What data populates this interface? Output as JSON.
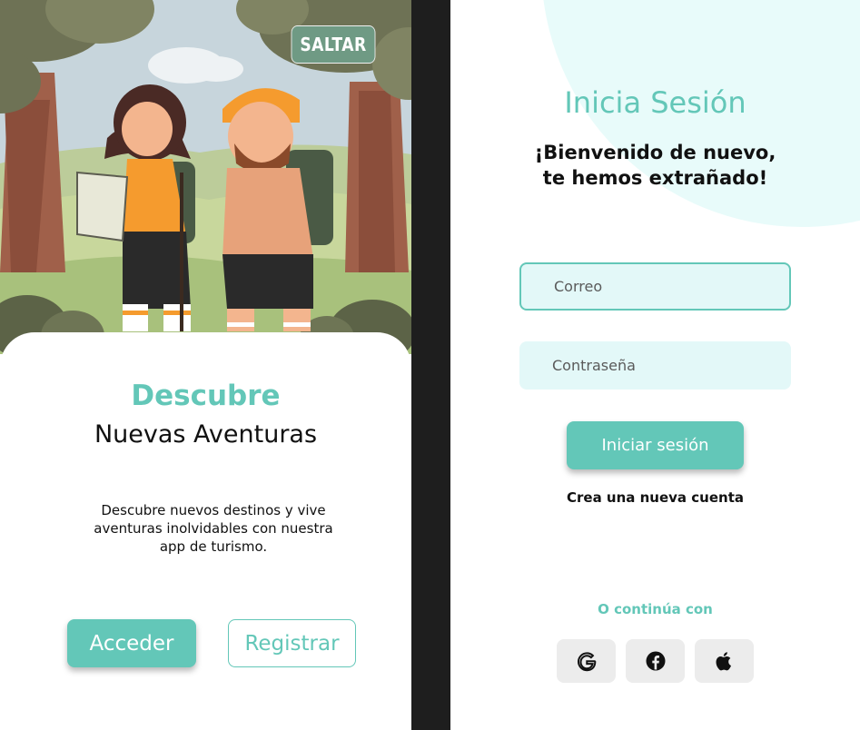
{
  "welcome": {
    "skip_label": "SALTAR",
    "title": "Descubre",
    "subtitle": "Nuevas Aventuras",
    "description": "Descubre nuevos destinos y vive aventuras inolvidables con nuestra app de turismo.",
    "login_label": "Acceder",
    "register_label": "Registrar"
  },
  "login": {
    "title": "Inicia Sesión",
    "welcome_line1": "¡Bienvenido de nuevo,",
    "welcome_line2": "te hemos extrañado!",
    "email_placeholder": "Correo",
    "password_placeholder": "Contraseña",
    "submit_label": "Iniciar sesión",
    "create_account": "Crea una nueva cuenta",
    "continue_with": "O continúa con",
    "social": [
      {
        "name": "google-icon"
      },
      {
        "name": "facebook-icon"
      },
      {
        "name": "apple-icon"
      }
    ]
  },
  "colors": {
    "accent": "#63c7b8",
    "skip_button": "#6f9a84",
    "input_bg": "#e3f8f8",
    "social_bg": "#ececec",
    "background": "#1e1e1e"
  }
}
